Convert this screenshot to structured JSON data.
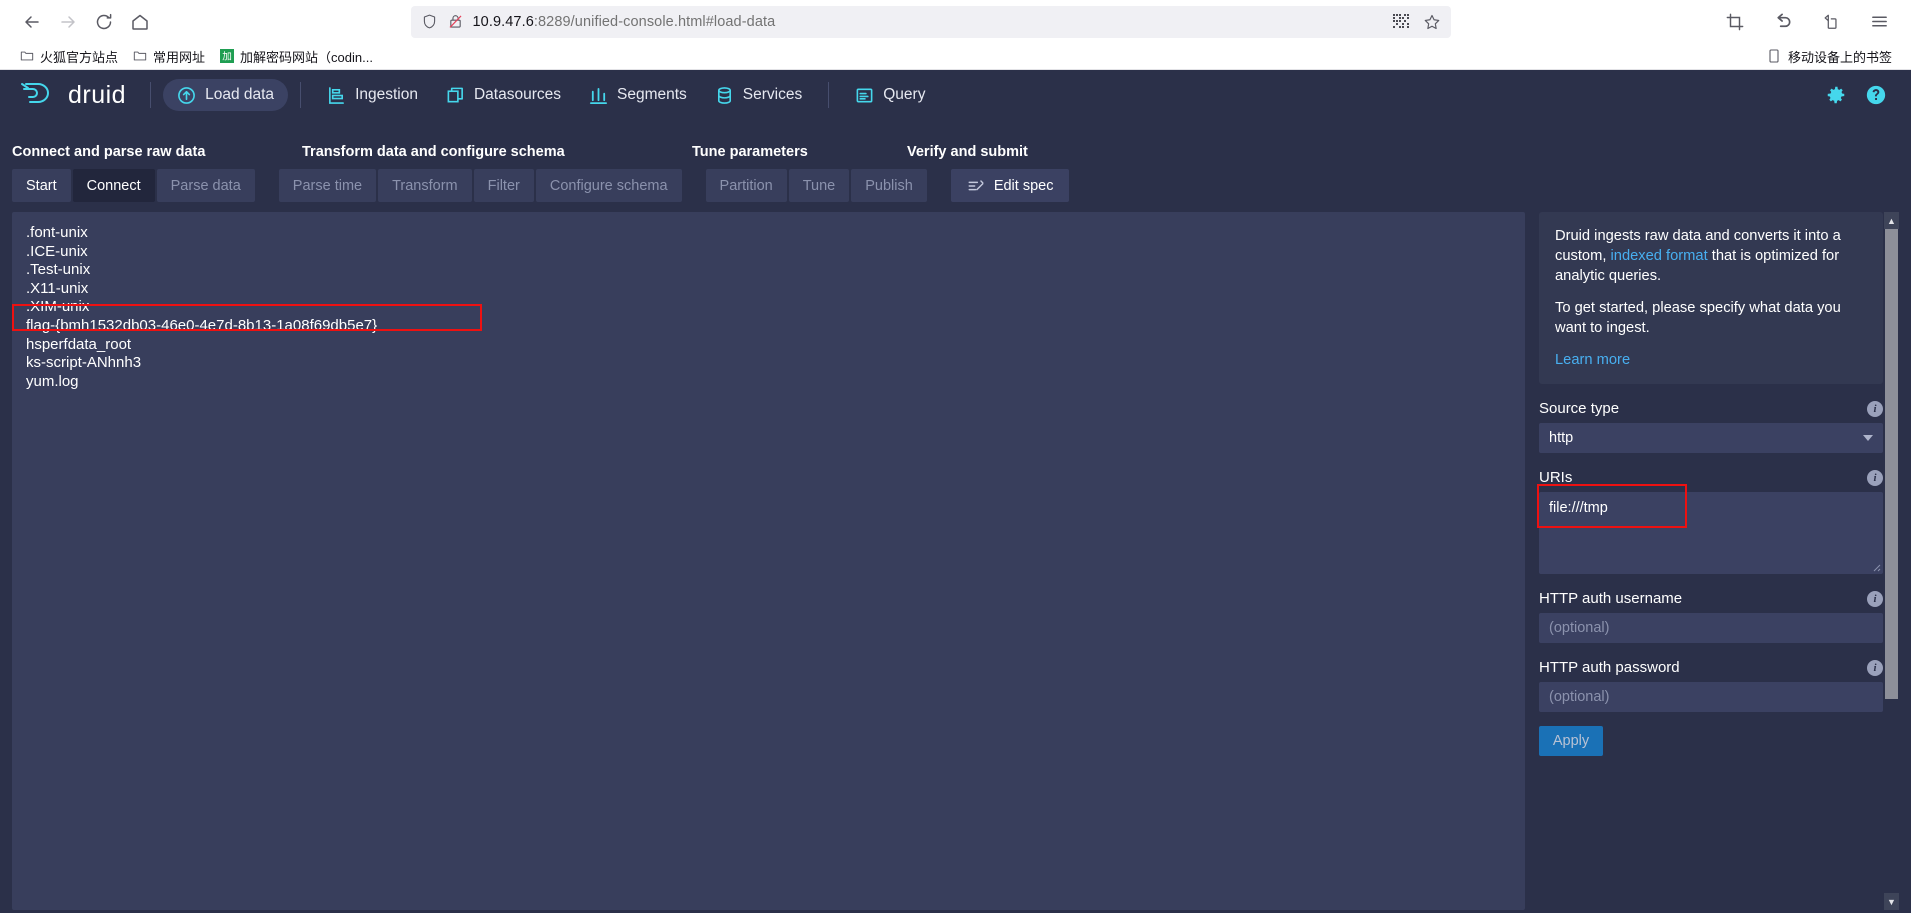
{
  "browser": {
    "back_label": "back-arrow",
    "forward_label": "forward-arrow",
    "reload_label": "reload",
    "home_label": "home",
    "url_host": "10.9.47.6",
    "url_rest": ":8289/unified-console.html#load-data",
    "bookmarks": [
      {
        "label": "火狐官方站点",
        "icon": "folder-icon"
      },
      {
        "label": "常用网址",
        "icon": "folder-icon"
      },
      {
        "label": "加解密码网站（codin...",
        "icon": "site-icon"
      }
    ],
    "mobile_bookmarks": "移动设备上的书签"
  },
  "druid_nav": {
    "logo": "druid",
    "items": [
      {
        "label": "Load data",
        "icon": "load-data-icon",
        "active": true
      },
      {
        "label": "Ingestion",
        "icon": "ingestion-icon",
        "active": false
      },
      {
        "label": "Datasources",
        "icon": "datasources-icon",
        "active": false
      },
      {
        "label": "Segments",
        "icon": "segments-icon",
        "active": false
      },
      {
        "label": "Services",
        "icon": "services-icon",
        "active": false
      },
      {
        "label": "Query",
        "icon": "query-icon",
        "active": false
      }
    ],
    "right_icons": [
      {
        "name": "gear-icon"
      },
      {
        "name": "help-icon"
      }
    ],
    "accent_color": "#45d7ec"
  },
  "wizard": {
    "sections": [
      {
        "title": "Connect and parse raw data"
      },
      {
        "title": "Transform data and configure schema"
      },
      {
        "title": "Tune parameters"
      },
      {
        "title": "Verify and submit"
      }
    ],
    "groups": [
      {
        "tabs": [
          {
            "label": "Start",
            "state": "enabled"
          },
          {
            "label": "Connect",
            "state": "current"
          },
          {
            "label": "Parse data",
            "state": "disabled"
          }
        ]
      },
      {
        "tabs": [
          {
            "label": "Parse time",
            "state": "disabled"
          },
          {
            "label": "Transform",
            "state": "disabled"
          },
          {
            "label": "Filter",
            "state": "disabled"
          },
          {
            "label": "Configure schema",
            "state": "disabled"
          }
        ]
      },
      {
        "tabs": [
          {
            "label": "Partition",
            "state": "disabled"
          },
          {
            "label": "Tune",
            "state": "disabled"
          },
          {
            "label": "Publish",
            "state": "disabled"
          }
        ]
      }
    ],
    "edit_spec_label": "Edit spec"
  },
  "data_preview": {
    "lines": [
      ".font-unix",
      ".ICE-unix",
      ".Test-unix",
      ".X11-unix",
      ".XIM-unix",
      "flag-{bmh1532db03-46e0-4e7d-8b13-1a08f69db5e7}",
      "hsperfdata_root",
      "ks-script-ANhnh3",
      "yum.log"
    ],
    "highlight_color": "#ee1111"
  },
  "info_panel": {
    "paragraph1_pre": "Druid ingests raw data and converts it into a custom, ",
    "paragraph1_link": "indexed format",
    "paragraph1_post": " that is optimized for analytic queries.",
    "paragraph2": "To get started, please specify what data you want to ingest.",
    "learn_more": "Learn more"
  },
  "form": {
    "source_type": {
      "label": "Source type",
      "value": "http"
    },
    "uris": {
      "label": "URIs",
      "value": "file:///tmp"
    },
    "http_auth_username": {
      "label": "HTTP auth username",
      "placeholder": "(optional)",
      "value": ""
    },
    "http_auth_password": {
      "label": "HTTP auth password",
      "placeholder": "(optional)",
      "value": ""
    },
    "apply_label": "Apply"
  }
}
